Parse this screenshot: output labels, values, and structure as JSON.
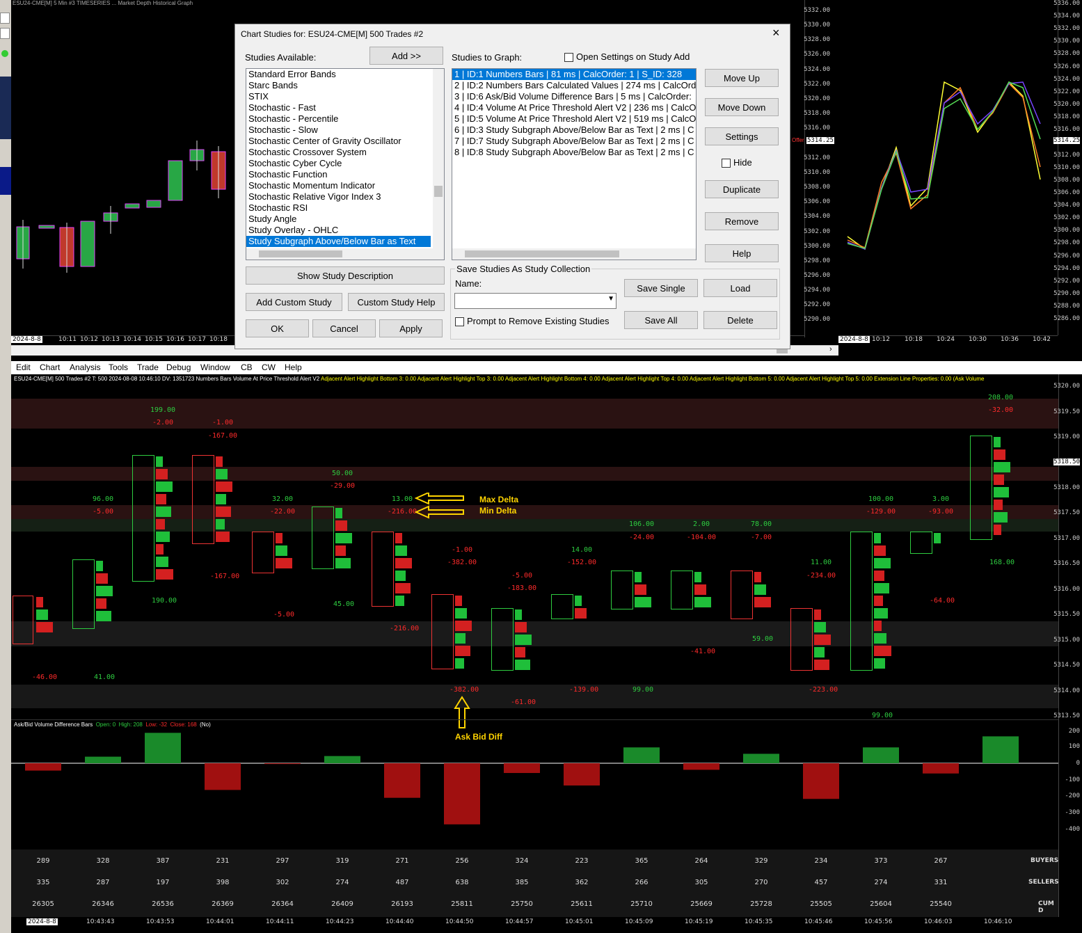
{
  "top_left_chart": {
    "header": "ESU24-CME[M] 5 Min #3 TIMESERIES ... Market Depth Historical Graph",
    "prices": [
      "5332.00",
      "5330.00",
      "5328.00",
      "5326.00",
      "5324.00",
      "5322.00",
      "5320.00",
      "5318.00",
      "5316.00",
      "5314.00",
      "5312.00",
      "5310.00",
      "5308.00",
      "5306.00",
      "5304.00",
      "5302.00",
      "5300.00",
      "5298.00",
      "5296.00",
      "5294.00",
      "5292.00",
      "5290.00"
    ],
    "times": [
      "10:11",
      "10:12",
      "10:13",
      "10:14",
      "10:15",
      "10:16",
      "10:17",
      "10:18"
    ],
    "date": "2024-8-8",
    "offer_label": "Offer",
    "offer_price": "5314.25"
  },
  "top_right_chart": {
    "prices": [
      "5336.00",
      "5334.00",
      "5332.00",
      "5330.00",
      "5328.00",
      "5326.00",
      "5324.00",
      "5322.00",
      "5320.00",
      "5318.00",
      "5316.00",
      "5314.25",
      "5312.00",
      "5310.00",
      "5308.00",
      "5306.00",
      "5304.00",
      "5302.00",
      "5300.00",
      "5298.00",
      "5296.00",
      "5294.00",
      "5292.00",
      "5290.00",
      "5288.00",
      "5286.00"
    ],
    "times": [
      "10:12",
      "10:18",
      "10:24",
      "10:30",
      "10:36",
      "10:42"
    ],
    "date": "2024-8-8"
  },
  "dialog": {
    "title": "Chart Studies for: ESU24-CME[M]  500 Trades #2",
    "studies_available_label": "Studies Available:",
    "add_button": "Add >>",
    "studies_to_graph_label": "Studies to Graph:",
    "open_settings_label": "Open Settings on Study Add",
    "available": [
      "Standard Error Bands",
      "Starc Bands",
      "STIX",
      "Stochastic - Fast",
      "Stochastic - Percentile",
      "Stochastic - Slow",
      "Stochastic Center of Gravity Oscillator",
      "Stochastic Crossover System",
      "Stochastic Cyber Cycle",
      "Stochastic Function",
      "Stochastic Momentum Indicator",
      "Stochastic Relative Vigor Index 3",
      "Stochastic RSI",
      "Study Angle",
      "Study Overlay - OHLC",
      "Study Subgraph Above/Below Bar as Text"
    ],
    "graph": [
      "1 | ID:1  Numbers Bars | 81 ms | CalcOrder: 1 | S_ID: 328",
      "2 | ID:2  Numbers Bars Calculated Values | 274 ms | CalcOrd",
      "3 | ID:6  Ask/Bid Volume Difference Bars | 5 ms | CalcOrder:",
      "4 | ID:4  Volume At Price Threshold Alert V2 | 236 ms | CalcO",
      "5 | ID:5  Volume At Price Threshold Alert V2 | 519 ms | CalcO",
      "6 | ID:3  Study Subgraph Above/Below Bar as Text | 2 ms | C",
      "7 | ID:7  Study Subgraph Above/Below Bar as Text | 2 ms | C",
      "8 | ID:8  Study Subgraph Above/Below Bar as Text | 2 ms | C"
    ],
    "move_up": "Move Up",
    "move_down": "Move Down",
    "settings": "Settings",
    "hide": "Hide",
    "duplicate": "Duplicate",
    "remove": "Remove",
    "help": "Help",
    "show_desc": "Show Study Description",
    "add_custom": "Add Custom Study",
    "custom_help": "Custom Study Help",
    "ok": "OK",
    "cancel": "Cancel",
    "apply": "Apply",
    "save_group": "Save Studies As Study Collection",
    "name_label": "Name:",
    "save_single": "Save Single",
    "load": "Load",
    "save_all": "Save All",
    "delete": "Delete",
    "prompt_remove": "Prompt to Remove Existing Studies"
  },
  "menu": [
    "Edit",
    "Chart",
    "Analysis",
    "Tools",
    "Trade",
    "Debug",
    "Window",
    "CB",
    "CW",
    "Help"
  ],
  "main_chart": {
    "header_white": "ESU24-CME[M]  500 Trades #2  T: 500  2024-08-08  10:46:10  DV: 1351723  Numbers Bars  Volume At Price Threshold Alert V2",
    "header_yellow": "Adjacent Alert Highlight Bottom 3: 0.00  Adjacent Alert Highlight Top 3: 0.00  Adjacent Alert Highlight Bottom 4: 0.00  Adjacent Alert Highlight Top 4: 0.00  Adjacent Alert Highlight Bottom 5: 0.00  Adjacent Alert Highlight Top 5: 0.00  Extension Line Properties: 0.00  (Ask Volume",
    "annotations": {
      "max_delta": "Max Delta",
      "min_delta": "Min Delta",
      "ask_bid_diff": "Ask Bid Diff"
    },
    "subpanel_title": "Ask/Bid Volume Difference Bars",
    "subpanel_open": "Open: 0",
    "subpanel_high": "High: 208",
    "subpanel_low": "Low: -32",
    "subpanel_close": "Close: 168",
    "subpanel_no": "(No)",
    "sub_axis": [
      "200",
      "100",
      "0",
      "-100",
      "-200",
      "-300",
      "-400"
    ],
    "prices": [
      "5320.00",
      "5319.50",
      "5319.00",
      "5318.50",
      "5318.00",
      "5317.50",
      "5317.00",
      "5316.50",
      "5316.00",
      "5315.50",
      "5315.00",
      "5314.50",
      "5314.00",
      "5313.50"
    ],
    "buyers_label": "BUYERS",
    "sellers_label": "SELLERS",
    "cumd_label": "CUM D",
    "buyers": [
      "289",
      "328",
      "387",
      "231",
      "297",
      "319",
      "271",
      "256",
      "324",
      "223",
      "365",
      "264",
      "329",
      "234",
      "373",
      "267"
    ],
    "sellers": [
      "335",
      "287",
      "197",
      "398",
      "302",
      "274",
      "487",
      "638",
      "385",
      "362",
      "266",
      "305",
      "270",
      "457",
      "274",
      "331"
    ],
    "cumd": [
      "26305",
      "26346",
      "26536",
      "26369",
      "26364",
      "26409",
      "26193",
      "25811",
      "25750",
      "25611",
      "25710",
      "25669",
      "25728",
      "25505",
      "25604",
      "25540"
    ],
    "times": [
      "10:43:43",
      "10:43:53",
      "10:44:01",
      "10:44:11",
      "10:44:23",
      "10:44:40",
      "10:44:50",
      "10:44:57",
      "10:45:01",
      "10:45:09",
      "10:45:19",
      "10:45:35",
      "10:45:46",
      "10:45:56",
      "10:46:03",
      "10:46:10"
    ],
    "date": "2024-8-8",
    "max_vals": [
      "96.00",
      "199.00",
      "-1.00",
      "32.00",
      "50.00",
      "13.00",
      "-1.00",
      "-5.00",
      "14.00",
      "106.00",
      "2.00",
      "78.00",
      "11.00",
      "100.00",
      "3.00",
      "208.00"
    ],
    "min_vals": [
      "-5.00",
      "-2.00",
      "-167.00",
      "-22.00",
      "-29.00",
      "-216.00",
      "-382.00",
      "-183.00",
      "-152.00",
      "-24.00",
      "-104.00",
      "-7.00",
      "-234.00",
      "-129.00",
      "-93.00",
      "-32.00"
    ],
    "ask_bid_diffs": [
      -46,
      41,
      190,
      -167,
      -5,
      45,
      -216,
      -382,
      -61,
      -139,
      99,
      -41,
      59,
      -223,
      99,
      -64,
      168
    ]
  }
}
